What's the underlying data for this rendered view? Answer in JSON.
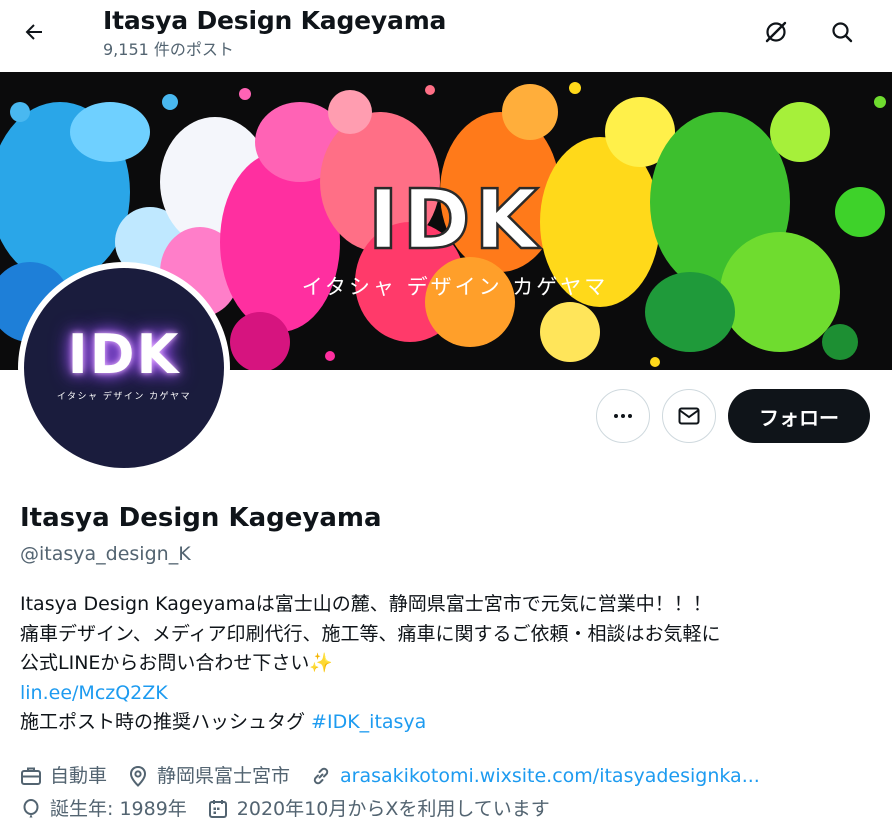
{
  "header": {
    "title": "Itasya Design Kageyama",
    "post_count": "9,151 件のポスト"
  },
  "banner": {
    "logo": "IDK",
    "subtitle": "イタシャ デザイン カゲヤマ"
  },
  "avatar": {
    "logo": "IDK",
    "subtitle": "イタシャ デザイン カゲヤマ"
  },
  "actions": {
    "follow_label": "フォロー"
  },
  "profile": {
    "display_name": "Itasya Design Kageyama",
    "handle": "@itasya_design_K",
    "bio_line1": "Itasya Design Kageyamaは富士山の麓、静岡県富士宮市で元気に営業中！！！",
    "bio_line2": "痛車デザイン、メディア印刷代行、施工等、痛車に関するご依頼・相談はお気軽に",
    "bio_line3": "公式LINEからお問い合わせ下さい",
    "bio_emoji": "✨",
    "bio_link": "lin.ee/MczQ2ZK",
    "bio_line5": "施工ポスト時の推奨ハッシュタグ ",
    "bio_hashtag": "#IDK_itasya"
  },
  "meta": {
    "category": "自動車",
    "location": "静岡県富士宮市",
    "website": "arasakikotomi.wixsite.com/itasyadesignka...",
    "birthday": "誕生年: 1989年",
    "joined": "2020年10月からXを利用しています"
  },
  "colors": {
    "link": "#1d9bf0",
    "text": "#0f1419",
    "secondary": "#536471",
    "follow_button": "#0f1419"
  },
  "icons": [
    "back-arrow-icon",
    "grok-icon",
    "search-icon",
    "more-icon",
    "mail-icon",
    "briefcase-icon",
    "location-pin-icon",
    "link-icon",
    "balloon-icon",
    "calendar-icon"
  ]
}
